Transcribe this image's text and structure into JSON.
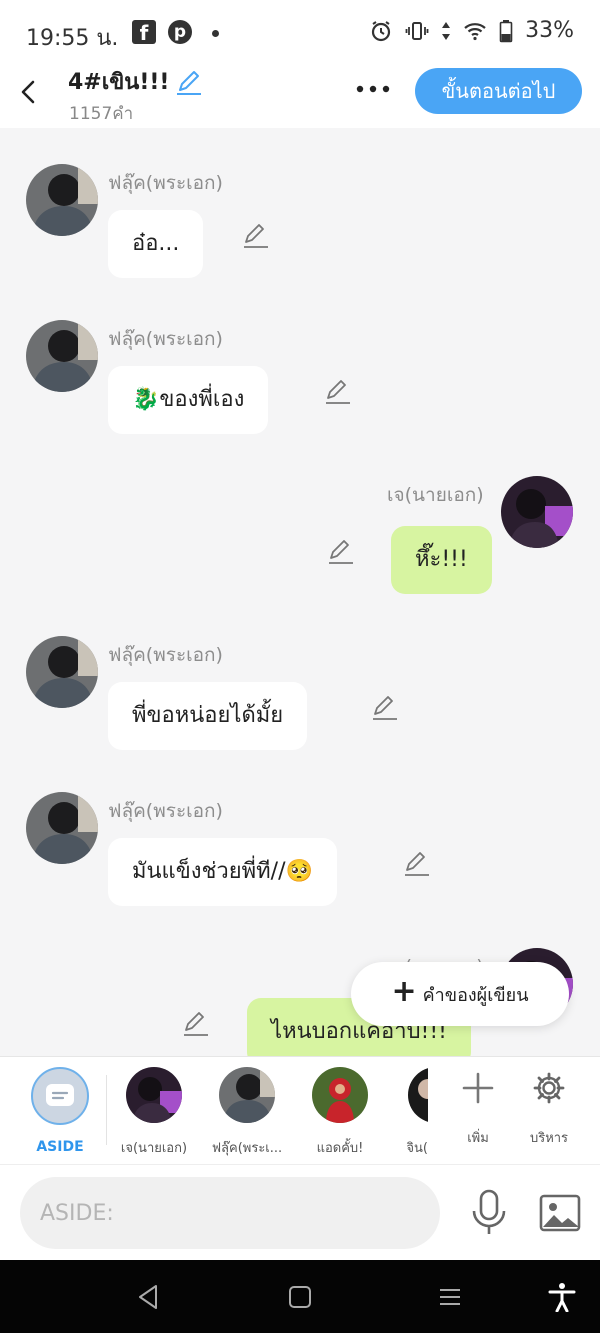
{
  "status_bar": {
    "time": "19:55 น.",
    "battery": "33%"
  },
  "header": {
    "title": "4#เขิน!!!",
    "word_count": "1157คำ",
    "next_button": "ขั้นตอนต่อไป"
  },
  "messages": [
    {
      "side": "left",
      "sender": "ฟลุ๊ค(พระเอก)",
      "text": "อ๋อ..."
    },
    {
      "side": "left",
      "sender": "ฟลุ๊ค(พระเอก)",
      "text": "🐉ของพี่เอง"
    },
    {
      "side": "right",
      "sender": "เจ(นายเอก)",
      "text": "หึ๊ะ!!!"
    },
    {
      "side": "left",
      "sender": "ฟลุ๊ค(พระเอก)",
      "text": "พี่ขอหน่อยได้มั้ย"
    },
    {
      "side": "left",
      "sender": "ฟลุ๊ค(พระเอก)",
      "text": "มันแข็งช่วยพี่ที//🥺"
    },
    {
      "side": "right",
      "sender": "เจ(นายเอก)",
      "text": "ไหนบอกแค่อาบ!!!"
    }
  ],
  "author_button": "คำของผู้เขียน",
  "characters": {
    "aside": "ASIDE",
    "items": [
      "เจ(นายเอก)",
      "ฟลุ๊ค(พระเ...",
      "แอดคั้บ!",
      "จิน("
    ],
    "add": "เพิ่ม",
    "manage": "บริหาร"
  },
  "input": {
    "placeholder": "ASIDE:"
  },
  "colors": {
    "accent": "#4aa5f5",
    "left_bubble": "#ffffff",
    "right_bubble": "#d7f4a1",
    "background": "#f5f5f6"
  }
}
